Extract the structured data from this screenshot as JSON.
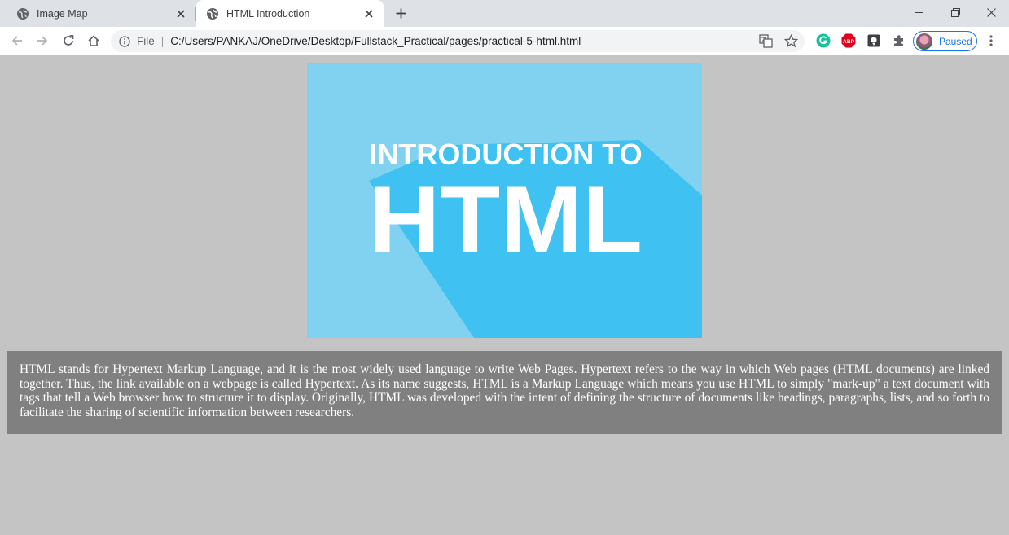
{
  "browser": {
    "tabs": [
      {
        "title": "Image Map",
        "active": false
      },
      {
        "title": "HTML Introduction",
        "active": true
      }
    ],
    "address": {
      "scheme_label": "File",
      "path": "C:/Users/PANKAJ/OneDrive/Desktop/Fullstack_Practical/pages/practical-5-html.html"
    },
    "profile": {
      "status": "Paused"
    },
    "extensions": [
      "grammarly-icon",
      "adblock-plus-icon",
      "extension-shield-icon",
      "puzzle-icon"
    ],
    "extension_labels": {
      "adblock": "ABP"
    }
  },
  "page": {
    "hero_image": {
      "line1": "INTRODUCTION TO",
      "line2": "HTML",
      "background_color": "#81d2f1",
      "shadow_color": "#3fc1f1"
    },
    "description": "HTML stands for Hypertext Markup Language, and it is the most widely used language to write Web Pages. Hypertext refers to the way in which Web pages (HTML documents) are linked together. Thus, the link available on a webpage is called Hypertext. As its name suggests, HTML is a Markup Language which means you use HTML to simply \"mark-up\" a text document with tags that tell a Web browser how to structure it to display. Originally, HTML was developed with the intent of defining the structure of documents like headings, paragraphs, lists, and so forth to facilitate the sharing of scientific information between researchers."
  },
  "colors": {
    "page_background": "#c4c4c4",
    "content_box": "#808080",
    "tabstrip": "#dee1e6",
    "accent": "#1a73e8"
  }
}
